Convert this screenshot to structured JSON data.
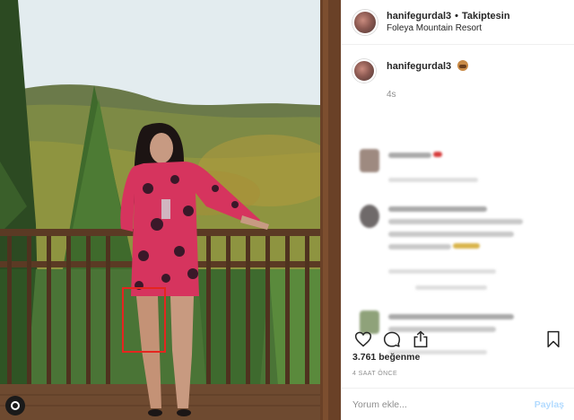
{
  "post": {
    "username": "hanifegurdal3",
    "separator": "•",
    "follow_label": "Takiptesin",
    "location": "Foleya Mountain Resort"
  },
  "caption": {
    "username": "hanifegurdal3",
    "emoji": "see-no-evil-monkey-icon",
    "time": "4s"
  },
  "actions": {
    "like_icon": "heart-icon",
    "comment_icon": "comment-icon",
    "share_icon": "share-icon",
    "save_icon": "bookmark-icon"
  },
  "likes_text": "3.761 beğenme",
  "posted_ago": "4 SAAT ÖNCE",
  "comment_input": {
    "placeholder": "Yorum ekle...",
    "post_label": "Paylaş"
  },
  "colors": {
    "accent_disabled": "#b3dbff",
    "highlight_box": "#e5251f",
    "muted_text": "#8e8e8e"
  }
}
